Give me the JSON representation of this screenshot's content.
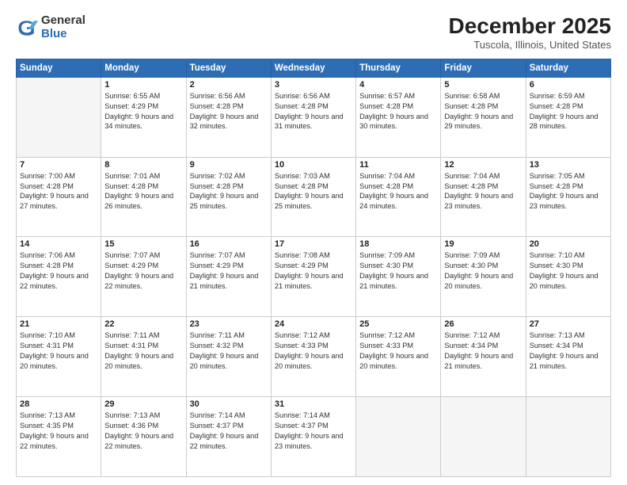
{
  "logo": {
    "general": "General",
    "blue": "Blue"
  },
  "header": {
    "title": "December 2025",
    "subtitle": "Tuscola, Illinois, United States"
  },
  "weekdays": [
    "Sunday",
    "Monday",
    "Tuesday",
    "Wednesday",
    "Thursday",
    "Friday",
    "Saturday"
  ],
  "weeks": [
    [
      {
        "day": "",
        "empty": true
      },
      {
        "day": "1",
        "sunrise": "6:55 AM",
        "sunset": "4:29 PM",
        "daylight": "9 hours and 34 minutes."
      },
      {
        "day": "2",
        "sunrise": "6:56 AM",
        "sunset": "4:28 PM",
        "daylight": "9 hours and 32 minutes."
      },
      {
        "day": "3",
        "sunrise": "6:56 AM",
        "sunset": "4:28 PM",
        "daylight": "9 hours and 31 minutes."
      },
      {
        "day": "4",
        "sunrise": "6:57 AM",
        "sunset": "4:28 PM",
        "daylight": "9 hours and 30 minutes."
      },
      {
        "day": "5",
        "sunrise": "6:58 AM",
        "sunset": "4:28 PM",
        "daylight": "9 hours and 29 minutes."
      },
      {
        "day": "6",
        "sunrise": "6:59 AM",
        "sunset": "4:28 PM",
        "daylight": "9 hours and 28 minutes."
      }
    ],
    [
      {
        "day": "7",
        "sunrise": "7:00 AM",
        "sunset": "4:28 PM",
        "daylight": "9 hours and 27 minutes."
      },
      {
        "day": "8",
        "sunrise": "7:01 AM",
        "sunset": "4:28 PM",
        "daylight": "9 hours and 26 minutes."
      },
      {
        "day": "9",
        "sunrise": "7:02 AM",
        "sunset": "4:28 PM",
        "daylight": "9 hours and 25 minutes."
      },
      {
        "day": "10",
        "sunrise": "7:03 AM",
        "sunset": "4:28 PM",
        "daylight": "9 hours and 25 minutes."
      },
      {
        "day": "11",
        "sunrise": "7:04 AM",
        "sunset": "4:28 PM",
        "daylight": "9 hours and 24 minutes."
      },
      {
        "day": "12",
        "sunrise": "7:04 AM",
        "sunset": "4:28 PM",
        "daylight": "9 hours and 23 minutes."
      },
      {
        "day": "13",
        "sunrise": "7:05 AM",
        "sunset": "4:28 PM",
        "daylight": "9 hours and 23 minutes."
      }
    ],
    [
      {
        "day": "14",
        "sunrise": "7:06 AM",
        "sunset": "4:28 PM",
        "daylight": "9 hours and 22 minutes."
      },
      {
        "day": "15",
        "sunrise": "7:07 AM",
        "sunset": "4:29 PM",
        "daylight": "9 hours and 22 minutes."
      },
      {
        "day": "16",
        "sunrise": "7:07 AM",
        "sunset": "4:29 PM",
        "daylight": "9 hours and 21 minutes."
      },
      {
        "day": "17",
        "sunrise": "7:08 AM",
        "sunset": "4:29 PM",
        "daylight": "9 hours and 21 minutes."
      },
      {
        "day": "18",
        "sunrise": "7:09 AM",
        "sunset": "4:30 PM",
        "daylight": "9 hours and 21 minutes."
      },
      {
        "day": "19",
        "sunrise": "7:09 AM",
        "sunset": "4:30 PM",
        "daylight": "9 hours and 20 minutes."
      },
      {
        "day": "20",
        "sunrise": "7:10 AM",
        "sunset": "4:30 PM",
        "daylight": "9 hours and 20 minutes."
      }
    ],
    [
      {
        "day": "21",
        "sunrise": "7:10 AM",
        "sunset": "4:31 PM",
        "daylight": "9 hours and 20 minutes."
      },
      {
        "day": "22",
        "sunrise": "7:11 AM",
        "sunset": "4:31 PM",
        "daylight": "9 hours and 20 minutes."
      },
      {
        "day": "23",
        "sunrise": "7:11 AM",
        "sunset": "4:32 PM",
        "daylight": "9 hours and 20 minutes."
      },
      {
        "day": "24",
        "sunrise": "7:12 AM",
        "sunset": "4:33 PM",
        "daylight": "9 hours and 20 minutes."
      },
      {
        "day": "25",
        "sunrise": "7:12 AM",
        "sunset": "4:33 PM",
        "daylight": "9 hours and 20 minutes."
      },
      {
        "day": "26",
        "sunrise": "7:12 AM",
        "sunset": "4:34 PM",
        "daylight": "9 hours and 21 minutes."
      },
      {
        "day": "27",
        "sunrise": "7:13 AM",
        "sunset": "4:34 PM",
        "daylight": "9 hours and 21 minutes."
      }
    ],
    [
      {
        "day": "28",
        "sunrise": "7:13 AM",
        "sunset": "4:35 PM",
        "daylight": "9 hours and 22 minutes."
      },
      {
        "day": "29",
        "sunrise": "7:13 AM",
        "sunset": "4:36 PM",
        "daylight": "9 hours and 22 minutes."
      },
      {
        "day": "30",
        "sunrise": "7:14 AM",
        "sunset": "4:37 PM",
        "daylight": "9 hours and 22 minutes."
      },
      {
        "day": "31",
        "sunrise": "7:14 AM",
        "sunset": "4:37 PM",
        "daylight": "9 hours and 23 minutes."
      },
      {
        "day": "",
        "empty": true
      },
      {
        "day": "",
        "empty": true
      },
      {
        "day": "",
        "empty": true
      }
    ]
  ]
}
